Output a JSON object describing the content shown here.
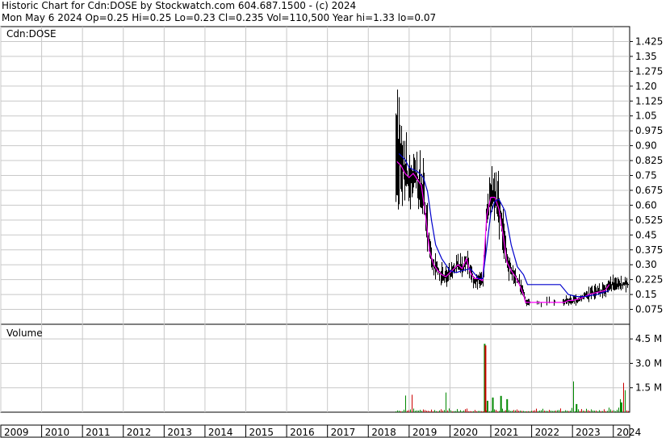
{
  "header": {
    "line1": "Historic Chart for Cdn:DOSE by Stockwatch.com 604.687.1500 - (c) 2024",
    "line2": "Mon May  6 2024  Op=0.25  Hi=0.25  Lo=0.23  Cl=0.235  Vol=110,500  Year hi=1.33  lo=0.07"
  },
  "chart_data": {
    "type": "line",
    "symbol_label": "Cdn:DOSE",
    "volume_label": "Volume",
    "x_axis": {
      "ticks": [
        "2009",
        "2010",
        "2011",
        "2012",
        "2013",
        "2014",
        "2015",
        "2016",
        "2017",
        "2018",
        "2019",
        "2020",
        "2021",
        "2022",
        "2023",
        "2024"
      ],
      "range": [
        2009.0,
        2024.4
      ]
    },
    "price_axis": {
      "ticks": [
        "1.425",
        "1.35",
        "1.275",
        "1.20",
        "1.125",
        "1.05",
        "0.975",
        "0.90",
        "0.825",
        "0.75",
        "0.675",
        "0.60",
        "0.525",
        "0.45",
        "0.375",
        "0.30",
        "0.225",
        "0.15",
        "0.075"
      ],
      "range": [
        0.0,
        1.5
      ]
    },
    "volume_axis": {
      "ticks": [
        "4.5 M",
        "3.0 M",
        "1.5 M"
      ],
      "tick_values": [
        4.5,
        3.0,
        1.5
      ],
      "range": [
        0,
        5.4
      ]
    },
    "grid": true,
    "colors": {
      "price_bars": "#000000",
      "short_ma": "#ff00ff",
      "long_ma": "#0000cc",
      "volume_up": "#008800",
      "volume_down": "#cc0000",
      "grid": "#c8c8c8"
    },
    "series": [
      {
        "values": [
          [
            2018.7,
            0.82
          ],
          [
            2018.8,
            0.8
          ],
          [
            2018.9,
            0.76
          ],
          [
            2019.0,
            0.74
          ],
          [
            2019.1,
            0.76
          ],
          [
            2019.2,
            0.73
          ],
          [
            2019.3,
            0.7
          ],
          [
            2019.4,
            0.55
          ],
          [
            2019.5,
            0.37
          ],
          [
            2019.6,
            0.3
          ],
          [
            2019.7,
            0.27
          ],
          [
            2019.8,
            0.25
          ],
          [
            2019.9,
            0.24
          ],
          [
            2020.0,
            0.26
          ],
          [
            2020.1,
            0.28
          ],
          [
            2020.2,
            0.3
          ],
          [
            2020.3,
            0.28
          ],
          [
            2020.4,
            0.33
          ],
          [
            2020.5,
            0.26
          ],
          [
            2020.6,
            0.23
          ],
          [
            2020.7,
            0.23
          ],
          [
            2020.8,
            0.22
          ],
          [
            2020.9,
            0.55
          ],
          [
            2021.0,
            0.64
          ],
          [
            2021.1,
            0.64
          ],
          [
            2021.2,
            0.58
          ],
          [
            2021.3,
            0.45
          ],
          [
            2021.4,
            0.31
          ],
          [
            2021.5,
            0.27
          ],
          [
            2021.6,
            0.24
          ],
          [
            2021.7,
            0.2
          ],
          [
            2021.8,
            0.15
          ],
          [
            2021.85,
            0.11
          ],
          [
            2022.0,
            0.11
          ],
          [
            2022.3,
            0.11
          ],
          [
            2022.6,
            0.11
          ],
          [
            2022.8,
            0.11
          ],
          [
            2022.9,
            0.12
          ],
          [
            2023.0,
            0.12
          ],
          [
            2023.2,
            0.13
          ],
          [
            2023.4,
            0.15
          ],
          [
            2023.6,
            0.16
          ],
          [
            2023.8,
            0.17
          ],
          [
            2023.9,
            0.2
          ]
        ]
      },
      {
        "values": [
          [
            2018.75,
            0.86
          ],
          [
            2018.9,
            0.83
          ],
          [
            2019.0,
            0.79
          ],
          [
            2019.2,
            0.77
          ],
          [
            2019.35,
            0.74
          ],
          [
            2019.45,
            0.67
          ],
          [
            2019.55,
            0.52
          ],
          [
            2019.65,
            0.4
          ],
          [
            2019.8,
            0.33
          ],
          [
            2020.0,
            0.27
          ],
          [
            2020.15,
            0.26
          ],
          [
            2020.3,
            0.27
          ],
          [
            2020.5,
            0.28
          ],
          [
            2020.7,
            0.23
          ],
          [
            2020.8,
            0.23
          ],
          [
            2020.9,
            0.39
          ],
          [
            2021.0,
            0.56
          ],
          [
            2021.1,
            0.62
          ],
          [
            2021.2,
            0.63
          ],
          [
            2021.35,
            0.57
          ],
          [
            2021.5,
            0.4
          ],
          [
            2021.65,
            0.29
          ],
          [
            2021.8,
            0.25
          ],
          [
            2021.9,
            0.2
          ],
          [
            2022.0,
            0.2
          ],
          [
            2022.4,
            0.2
          ],
          [
            2022.7,
            0.2
          ],
          [
            2022.9,
            0.15
          ],
          [
            2023.1,
            0.14
          ],
          [
            2023.3,
            0.14
          ],
          [
            2023.6,
            0.15
          ],
          [
            2023.9,
            0.17
          ]
        ]
      }
    ]
  }
}
